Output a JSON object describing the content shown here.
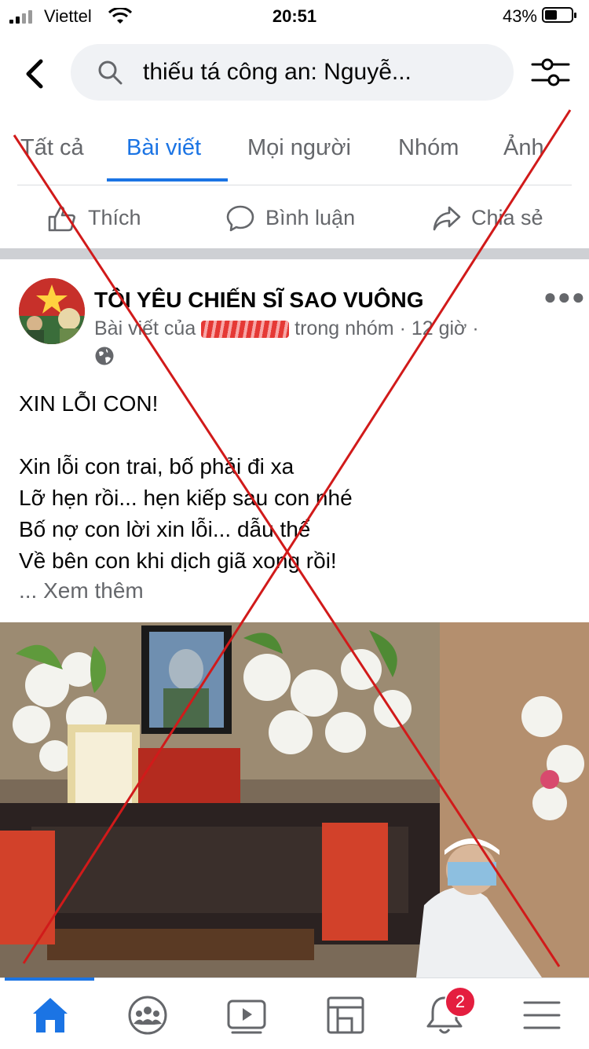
{
  "status_bar": {
    "carrier": "Viettel",
    "time": "20:51",
    "battery": "43%"
  },
  "search": {
    "query": "thiếu tá công an: Nguyễ..."
  },
  "tabs": [
    {
      "label": "Tất cả"
    },
    {
      "label": "Bài viết"
    },
    {
      "label": "Mọi người"
    },
    {
      "label": "Nhóm"
    },
    {
      "label": "Ảnh"
    }
  ],
  "reactions": {
    "like": "Thích",
    "comment": "Bình luận",
    "share": "Chia sẻ"
  },
  "post": {
    "group_name": "TÔI YÊU CHIẾN SĨ SAO VUÔNG",
    "meta_prefix": "Bài viết của",
    "meta_suffix": "trong nhóm · 12 giờ ·",
    "title": "XIN LỖI CON!",
    "lines": [
      "Xin lỗi con trai, bố phải đi xa",
      "Lỡ hẹn rồi... hẹn kiếp sau con nhé",
      "Bố nợ con lời xin lỗi... dẫu thể",
      "Về bên con khi dịch giã xong rồi!"
    ],
    "see_more": "... Xem thêm"
  },
  "bottom_nav": {
    "notifications_badge": "2"
  },
  "colors": {
    "accent": "#1b74e4",
    "badge": "#e41e3f",
    "cross": "#d11a1a"
  }
}
